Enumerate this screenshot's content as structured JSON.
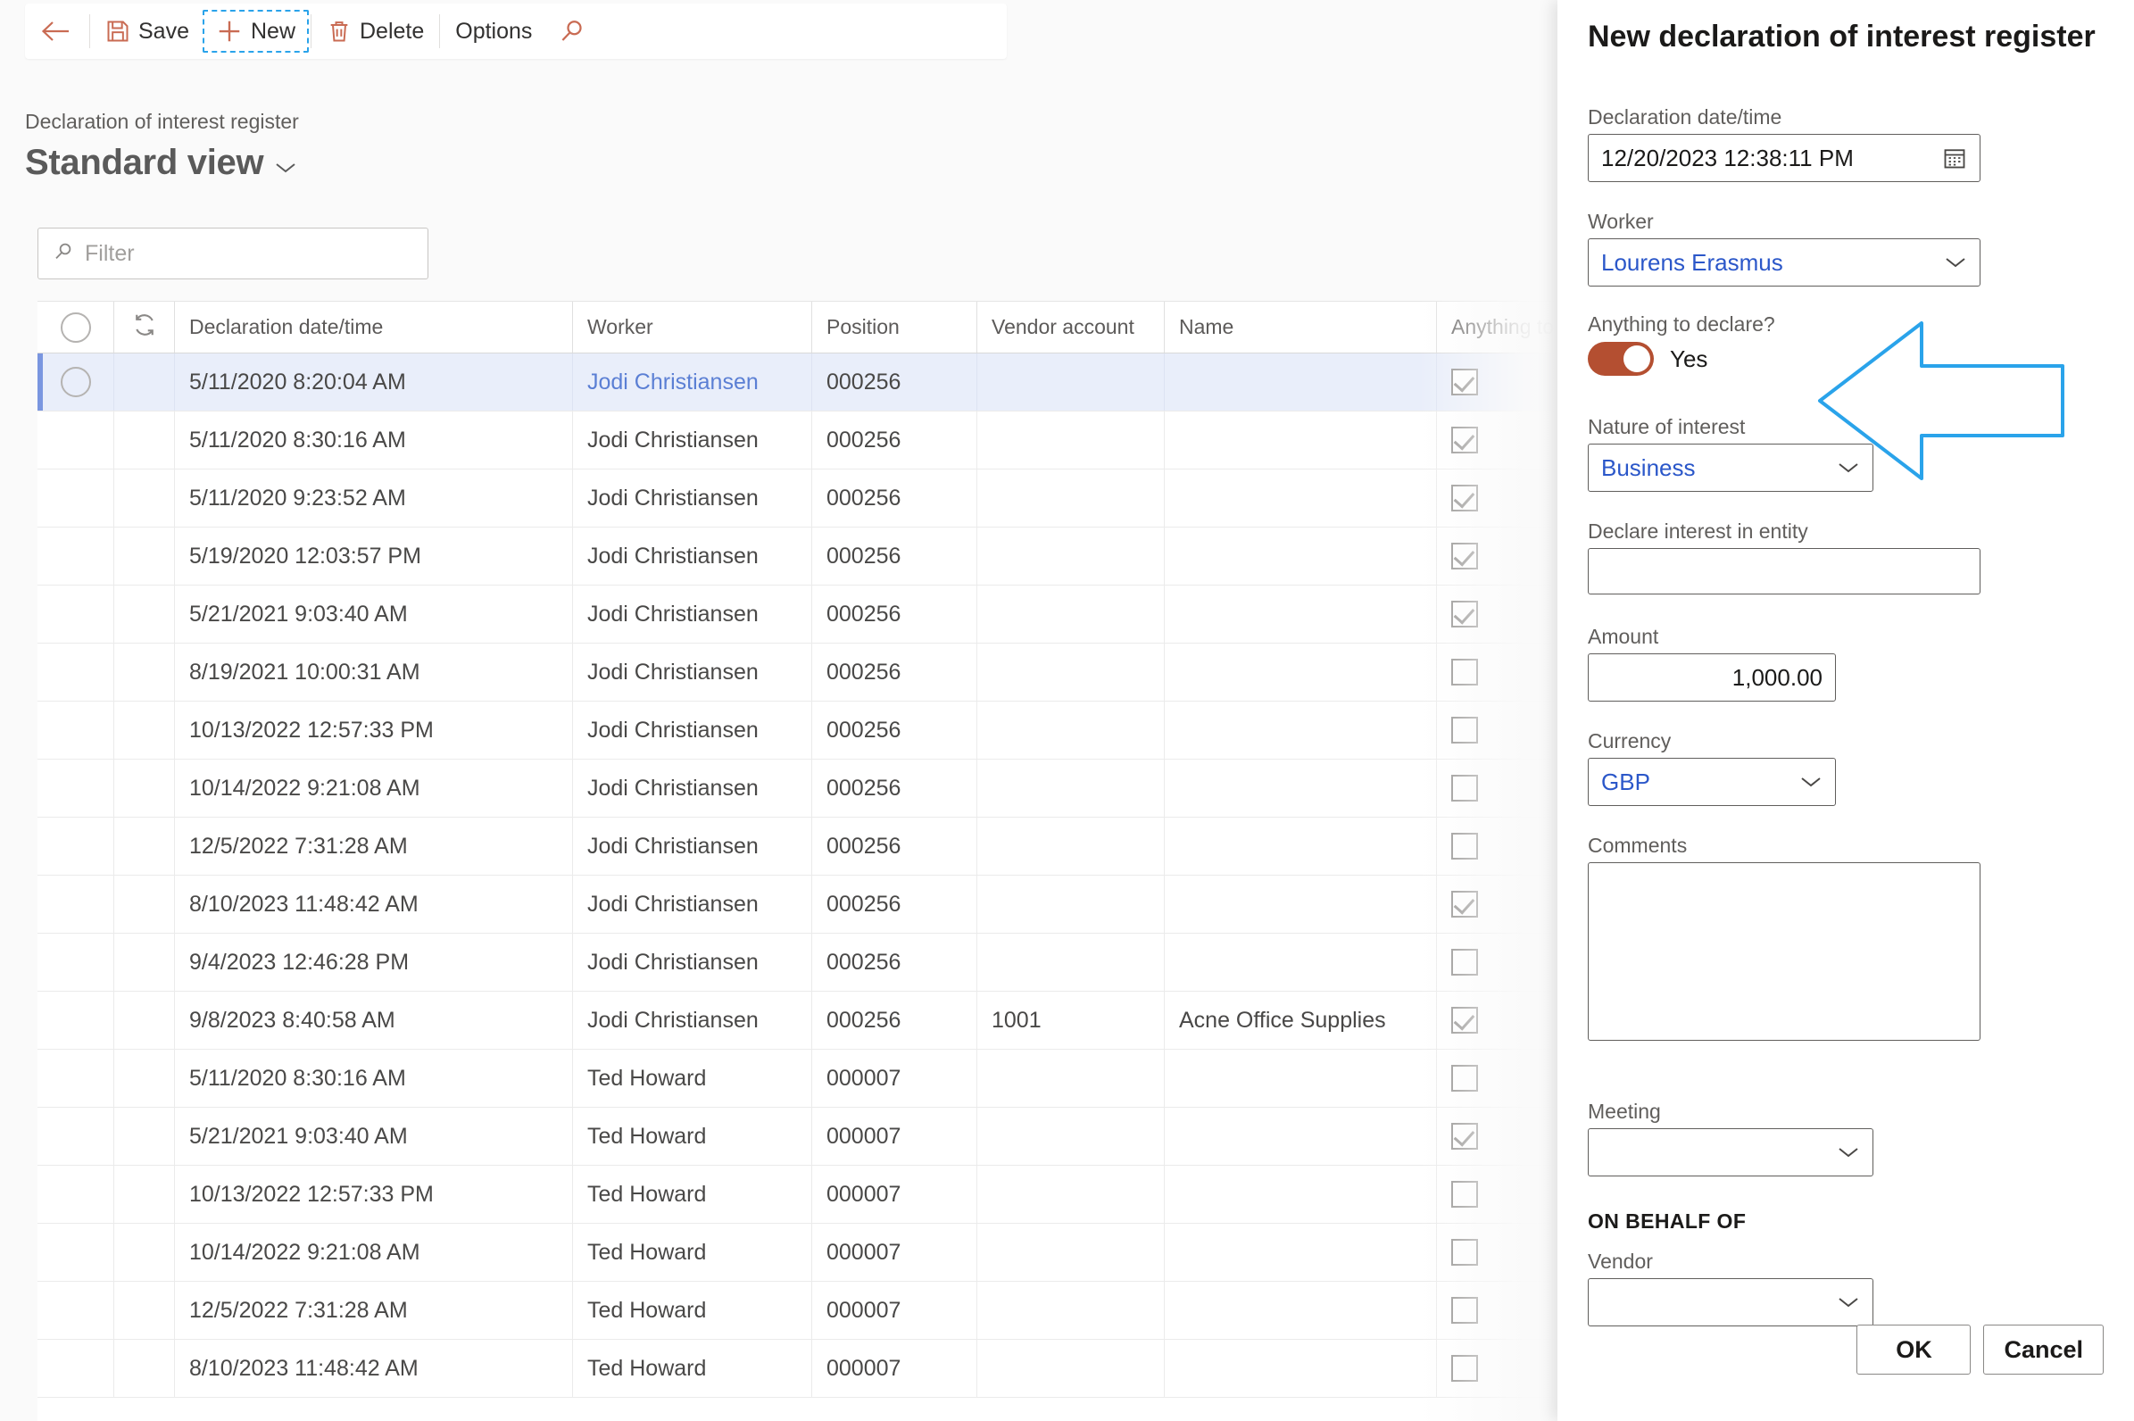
{
  "toolbar": {
    "back_label": "",
    "save_label": "Save",
    "new_label": "New",
    "delete_label": "Delete",
    "options_label": "Options",
    "search_label": ""
  },
  "page": {
    "breadcrumb": "Declaration of interest register",
    "title": "Standard view"
  },
  "filter": {
    "placeholder": "Filter",
    "value": ""
  },
  "grid": {
    "columns": [
      "Declaration date/time",
      "Worker",
      "Position",
      "Vendor account",
      "Name",
      "Anything to"
    ],
    "rows": [
      {
        "date": "5/11/2020 8:20:04 AM",
        "worker": "Jodi Christiansen",
        "position": "000256",
        "vendor": "",
        "name": "",
        "declare": true,
        "selected": true,
        "worker_is_link": true
      },
      {
        "date": "5/11/2020 8:30:16 AM",
        "worker": "Jodi Christiansen",
        "position": "000256",
        "vendor": "",
        "name": "",
        "declare": true,
        "selected": false,
        "worker_is_link": false
      },
      {
        "date": "5/11/2020 9:23:52 AM",
        "worker": "Jodi Christiansen",
        "position": "000256",
        "vendor": "",
        "name": "",
        "declare": true,
        "selected": false,
        "worker_is_link": false
      },
      {
        "date": "5/19/2020 12:03:57 PM",
        "worker": "Jodi Christiansen",
        "position": "000256",
        "vendor": "",
        "name": "",
        "declare": true,
        "selected": false,
        "worker_is_link": false
      },
      {
        "date": "5/21/2021 9:03:40 AM",
        "worker": "Jodi Christiansen",
        "position": "000256",
        "vendor": "",
        "name": "",
        "declare": true,
        "selected": false,
        "worker_is_link": false
      },
      {
        "date": "8/19/2021 10:00:31 AM",
        "worker": "Jodi Christiansen",
        "position": "000256",
        "vendor": "",
        "name": "",
        "declare": false,
        "selected": false,
        "worker_is_link": false
      },
      {
        "date": "10/13/2022 12:57:33 PM",
        "worker": "Jodi Christiansen",
        "position": "000256",
        "vendor": "",
        "name": "",
        "declare": false,
        "selected": false,
        "worker_is_link": false
      },
      {
        "date": "10/14/2022 9:21:08 AM",
        "worker": "Jodi Christiansen",
        "position": "000256",
        "vendor": "",
        "name": "",
        "declare": false,
        "selected": false,
        "worker_is_link": false
      },
      {
        "date": "12/5/2022 7:31:28 AM",
        "worker": "Jodi Christiansen",
        "position": "000256",
        "vendor": "",
        "name": "",
        "declare": false,
        "selected": false,
        "worker_is_link": false
      },
      {
        "date": "8/10/2023 11:48:42 AM",
        "worker": "Jodi Christiansen",
        "position": "000256",
        "vendor": "",
        "name": "",
        "declare": true,
        "selected": false,
        "worker_is_link": false
      },
      {
        "date": "9/4/2023 12:46:28 PM",
        "worker": "Jodi Christiansen",
        "position": "000256",
        "vendor": "",
        "name": "",
        "declare": false,
        "selected": false,
        "worker_is_link": false
      },
      {
        "date": "9/8/2023 8:40:58 AM",
        "worker": "Jodi Christiansen",
        "position": "000256",
        "vendor": "1001",
        "name": "Acne Office Supplies",
        "declare": true,
        "selected": false,
        "worker_is_link": false
      },
      {
        "date": "5/11/2020 8:30:16 AM",
        "worker": "Ted Howard",
        "position": "000007",
        "vendor": "",
        "name": "",
        "declare": false,
        "selected": false,
        "worker_is_link": false
      },
      {
        "date": "5/21/2021 9:03:40 AM",
        "worker": "Ted Howard",
        "position": "000007",
        "vendor": "",
        "name": "",
        "declare": true,
        "selected": false,
        "worker_is_link": false
      },
      {
        "date": "10/13/2022 12:57:33 PM",
        "worker": "Ted Howard",
        "position": "000007",
        "vendor": "",
        "name": "",
        "declare": false,
        "selected": false,
        "worker_is_link": false
      },
      {
        "date": "10/14/2022 9:21:08 AM",
        "worker": "Ted Howard",
        "position": "000007",
        "vendor": "",
        "name": "",
        "declare": false,
        "selected": false,
        "worker_is_link": false
      },
      {
        "date": "12/5/2022 7:31:28 AM",
        "worker": "Ted Howard",
        "position": "000007",
        "vendor": "",
        "name": "",
        "declare": false,
        "selected": false,
        "worker_is_link": false
      },
      {
        "date": "8/10/2023 11:48:42 AM",
        "worker": "Ted Howard",
        "position": "000007",
        "vendor": "",
        "name": "",
        "declare": false,
        "selected": false,
        "worker_is_link": false
      }
    ]
  },
  "panel": {
    "title": "New declaration of interest register",
    "declaration_datetime": {
      "label": "Declaration date/time",
      "value": "12/20/2023 12:38:11 PM"
    },
    "worker": {
      "label": "Worker",
      "value": "Lourens Erasmus"
    },
    "anything_to_declare": {
      "label": "Anything to declare?",
      "value": "Yes",
      "on": true
    },
    "nature_of_interest": {
      "label": "Nature of interest",
      "value": "Business"
    },
    "declare_interest_in_entity": {
      "label": "Declare interest in entity",
      "value": ""
    },
    "amount": {
      "label": "Amount",
      "value": "1,000.00"
    },
    "currency": {
      "label": "Currency",
      "value": "GBP"
    },
    "comments": {
      "label": "Comments",
      "value": ""
    },
    "meeting": {
      "label": "Meeting",
      "value": ""
    },
    "on_behalf_of_section": "ON BEHALF OF",
    "vendor": {
      "label": "Vendor",
      "value": ""
    },
    "ok_label": "OK",
    "cancel_label": "Cancel"
  },
  "colors": {
    "accent_icon": "#c96b53",
    "toggle_on": "#b44f31",
    "link": "#2b57c9",
    "grid_link": "#5b7fd4",
    "selection_bar": "#7a96e0",
    "annotation": "#2aa3ea"
  }
}
